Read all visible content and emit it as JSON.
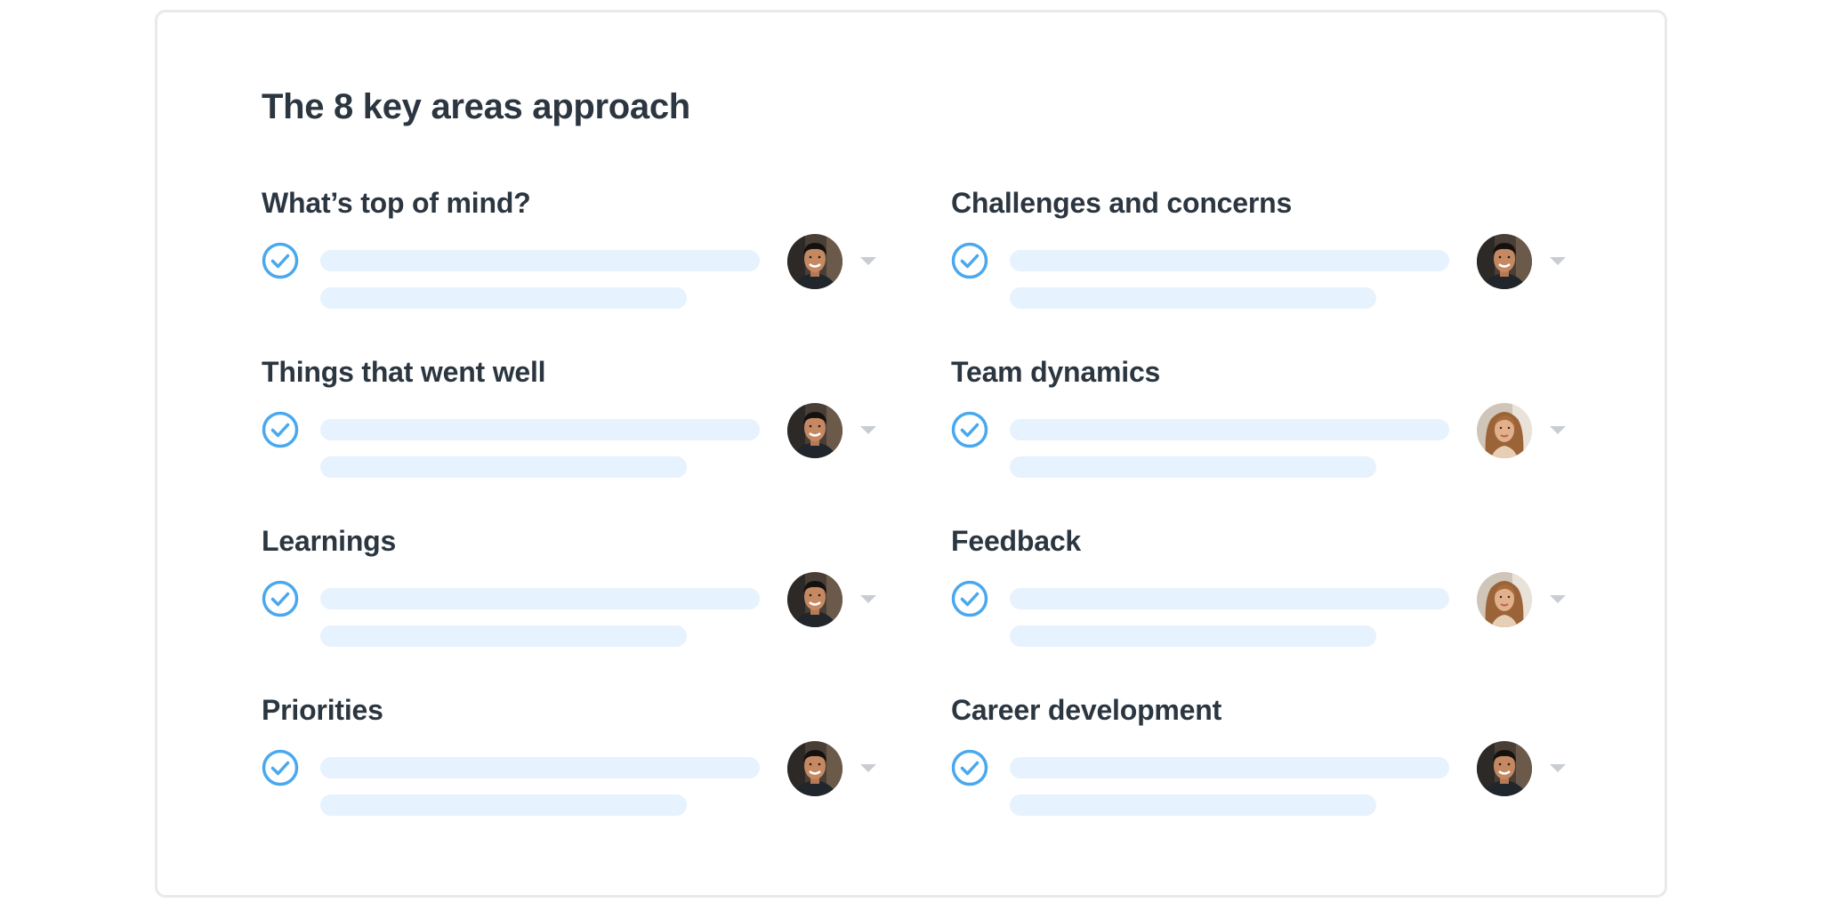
{
  "page": {
    "title": "The 8 key areas approach"
  },
  "colors": {
    "heading": "#2b3640",
    "check": "#4aa8ee",
    "placeholder_line": "#e6f2fd",
    "caret": "#c9cdd2",
    "card_border": "#e8e9eb"
  },
  "areas": [
    {
      "label": "What’s top of mind?",
      "done": true,
      "assignee": "man-avatar"
    },
    {
      "label": "Challenges and concerns",
      "done": true,
      "assignee": "man-avatar"
    },
    {
      "label": "Things that went well",
      "done": true,
      "assignee": "man-avatar"
    },
    {
      "label": "Team dynamics",
      "done": true,
      "assignee": "woman-avatar"
    },
    {
      "label": "Learnings",
      "done": true,
      "assignee": "man-avatar"
    },
    {
      "label": "Feedback",
      "done": true,
      "assignee": "woman-avatar"
    },
    {
      "label": "Priorities",
      "done": true,
      "assignee": "man-avatar"
    },
    {
      "label": "Career development",
      "done": true,
      "assignee": "man-avatar"
    }
  ],
  "icons": {
    "check": "check-circle-icon",
    "dropdown": "chevron-down-icon"
  }
}
